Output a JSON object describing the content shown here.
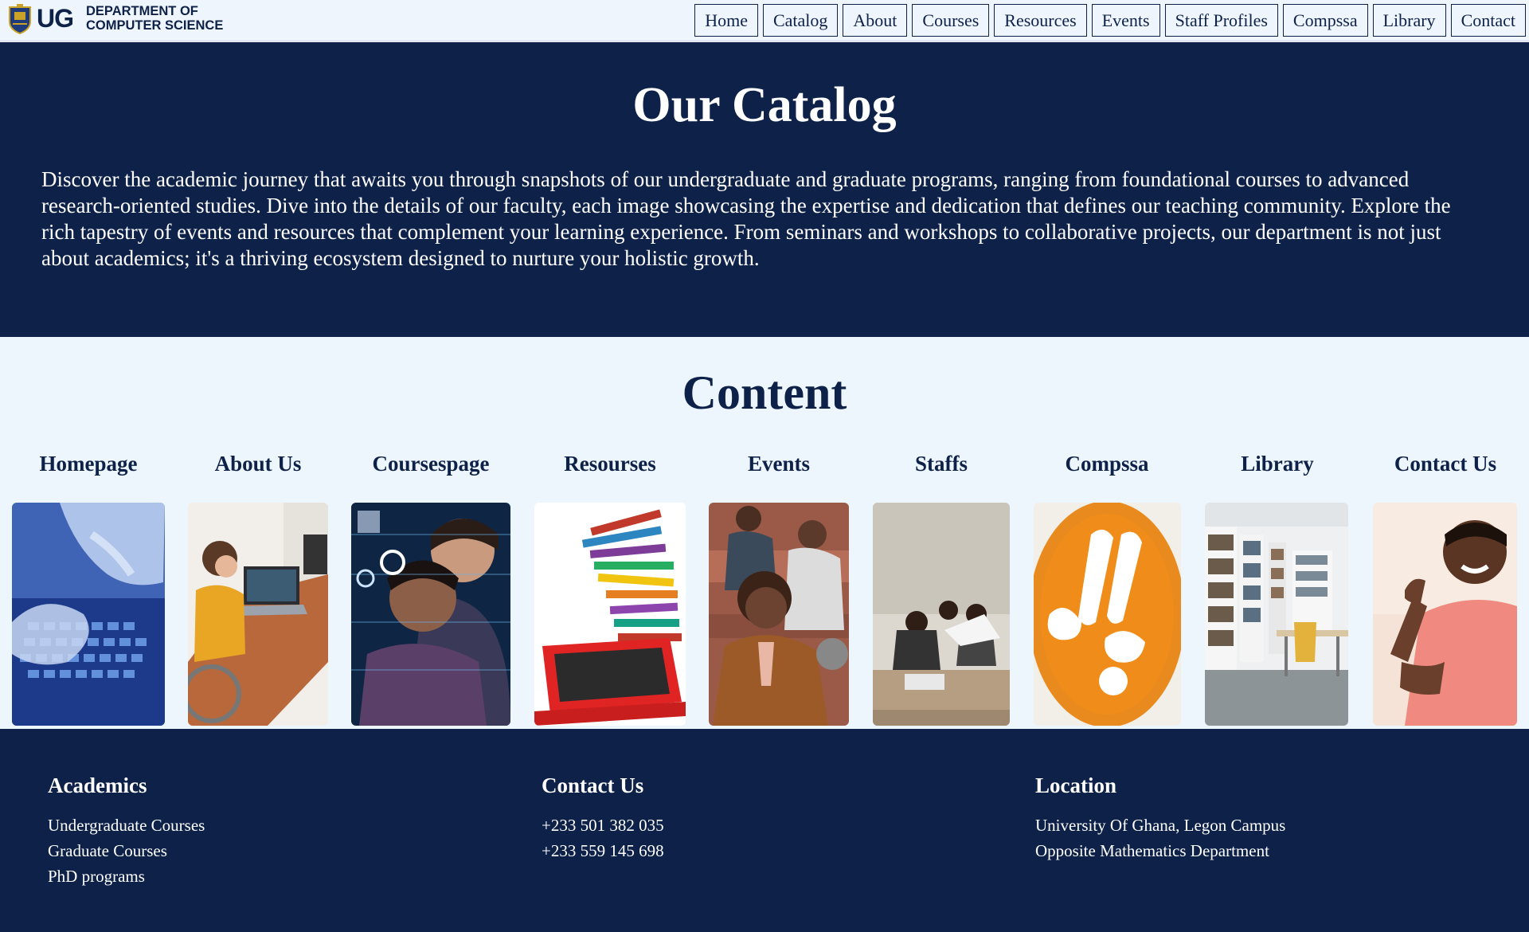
{
  "header": {
    "logo_text": "UG",
    "dept_line1": "DEPARTMENT OF",
    "dept_line2": "COMPUTER SCIENCE",
    "nav": [
      "Home",
      "Catalog",
      "About",
      "Courses",
      "Resources",
      "Events",
      "Staff Profiles",
      "Compssa",
      "Library",
      "Contact"
    ]
  },
  "hero": {
    "title": "Our Catalog",
    "text": "Discover the academic journey that awaits you through snapshots of our undergraduate and graduate programs, ranging from foundational courses to advanced research-oriented studies. Dive into the details of our faculty, each image showcasing the expertise and dedication that defines our teaching community. Explore the rich tapestry of events and resources that complement your learning experience. From seminars and workshops to collaborative projects, our department is not just about academics; it's a thriving ecosystem designed to nurture your holistic growth."
  },
  "content": {
    "title": "Content",
    "cards": [
      {
        "label": "Homepage",
        "image": "hands-typing-on-keyboard-image"
      },
      {
        "label": "About Us",
        "image": "student-at-laptop-desk-image"
      },
      {
        "label": "Coursespage",
        "image": "students-with-code-overlay-image"
      },
      {
        "label": "Resourses",
        "image": "books-stacked-on-laptop-image"
      },
      {
        "label": "Events",
        "image": "students-on-steps-image"
      },
      {
        "label": "Staffs",
        "image": "classroom-with-projector-image"
      },
      {
        "label": "Compssa",
        "image": "compssa-orange-logo-image"
      },
      {
        "label": "Library",
        "image": "library-bookshelves-image"
      },
      {
        "label": "Contact Us",
        "image": "man-making-call-gesture-image"
      }
    ]
  },
  "footer": {
    "academics": {
      "title": "Academics",
      "items": [
        "Undergraduate Courses",
        "Graduate Courses",
        "PhD programs"
      ]
    },
    "contact": {
      "title": "Contact Us",
      "items": [
        "+233 501 382 035",
        "+233 559 145 698"
      ]
    },
    "location": {
      "title": "Location",
      "items": [
        "University Of Ghana, Legon Campus",
        "Opposite Mathematics Department"
      ]
    }
  },
  "colors": {
    "navy": "#0e2149",
    "light": "#eef6fd",
    "orange": "#e98a1e"
  }
}
